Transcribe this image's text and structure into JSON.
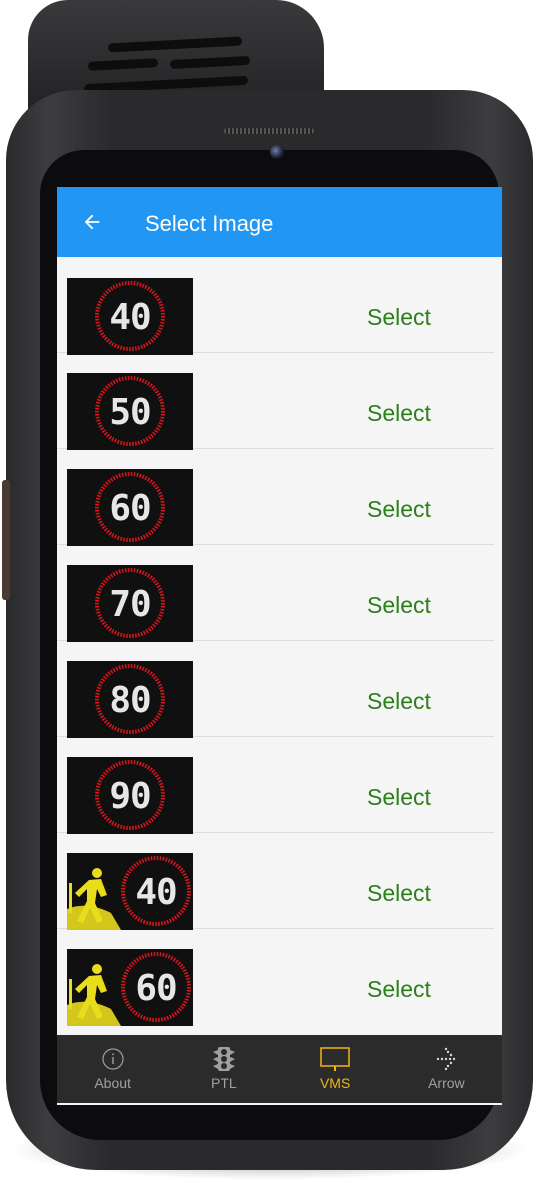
{
  "app": {
    "title": "Select Image"
  },
  "images": [
    {
      "sign_number": "40",
      "kind": "speed-sign",
      "action_label": "Select"
    },
    {
      "sign_number": "50",
      "kind": "speed-sign",
      "action_label": "Select"
    },
    {
      "sign_number": "60",
      "kind": "speed-sign",
      "action_label": "Select"
    },
    {
      "sign_number": "70",
      "kind": "speed-sign",
      "action_label": "Select"
    },
    {
      "sign_number": "80",
      "kind": "speed-sign",
      "action_label": "Select"
    },
    {
      "sign_number": "90",
      "kind": "speed-sign",
      "action_label": "Select"
    },
    {
      "sign_number": "40",
      "kind": "roadworks-speed-sign",
      "action_label": "Select"
    },
    {
      "sign_number": "60",
      "kind": "roadworks-speed-sign",
      "action_label": "Select"
    }
  ],
  "bottom_nav": {
    "tabs": [
      {
        "label": "About",
        "icon": "info-icon",
        "active": false
      },
      {
        "label": "PTL",
        "icon": "traffic-light-icon",
        "active": false
      },
      {
        "label": "VMS",
        "icon": "vms-board-icon",
        "active": true
      },
      {
        "label": "Arrow",
        "icon": "arrow-board-icon",
        "active": false
      }
    ]
  },
  "colors": {
    "app_bar": "#2196f3",
    "select_text": "#2e7d1a",
    "sign_ring": "#d4151b",
    "sign_digits": "#e6e6e6",
    "worker_figure": "#e8dc1c",
    "nav_background": "#2b2b2b",
    "nav_active": "#f3b510",
    "nav_inactive": "#a0a0a0"
  }
}
